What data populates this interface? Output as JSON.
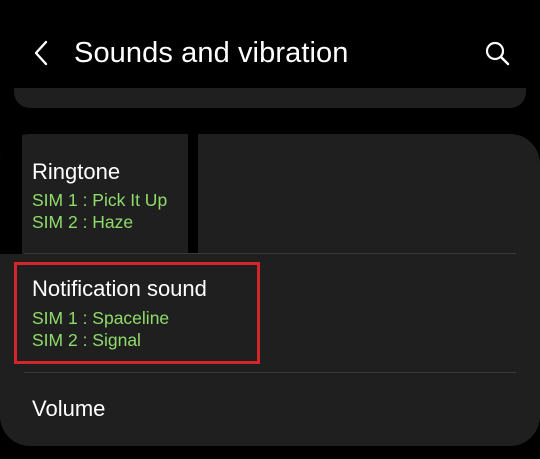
{
  "header": {
    "title": "Sounds and vibration",
    "back_icon": "chevron-left-icon",
    "search_icon": "search-icon"
  },
  "settings": {
    "ringtone": {
      "title": "Ringtone",
      "sim1": "SIM 1 : Pick It Up",
      "sim2": "SIM 2 : Haze"
    },
    "notification_sound": {
      "title": "Notification sound",
      "sim1": "SIM 1 : Spaceline",
      "sim2": "SIM 2 : Signal"
    },
    "volume": {
      "title": "Volume"
    }
  },
  "colors": {
    "background": "#000000",
    "card": "#1f1f1f",
    "accent_green": "#8fdc6b",
    "highlight_red": "#d3262c"
  }
}
